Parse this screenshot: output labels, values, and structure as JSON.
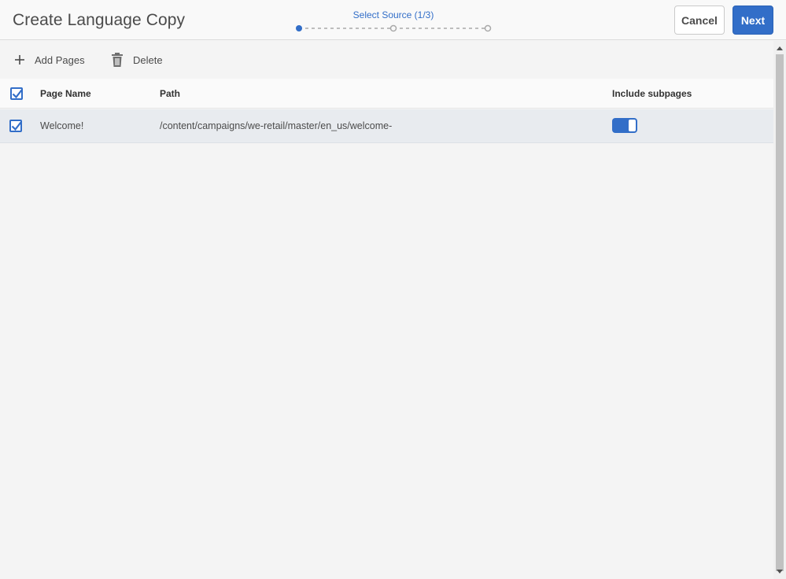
{
  "header": {
    "title": "Create Language Copy",
    "wizard_step_label": "Select Source (1/3)",
    "cancel_label": "Cancel",
    "next_label": "Next"
  },
  "toolbar": {
    "add_pages_label": "Add Pages",
    "delete_label": "Delete"
  },
  "table": {
    "columns": {
      "page_name": "Page Name",
      "path": "Path",
      "include_subpages": "Include subpages"
    },
    "rows": [
      {
        "page_name": "Welcome!",
        "path": "/content/campaigns/we-retail/master/en_us/welcome-",
        "selected": true,
        "include_subpages": true
      }
    ]
  },
  "colors": {
    "accent": "#326ec8",
    "selected_row": "#e8ebef"
  },
  "icons": [
    "plus-icon",
    "trash-icon",
    "checkmark-icon",
    "scroll-up-icon",
    "scroll-down-icon"
  ]
}
